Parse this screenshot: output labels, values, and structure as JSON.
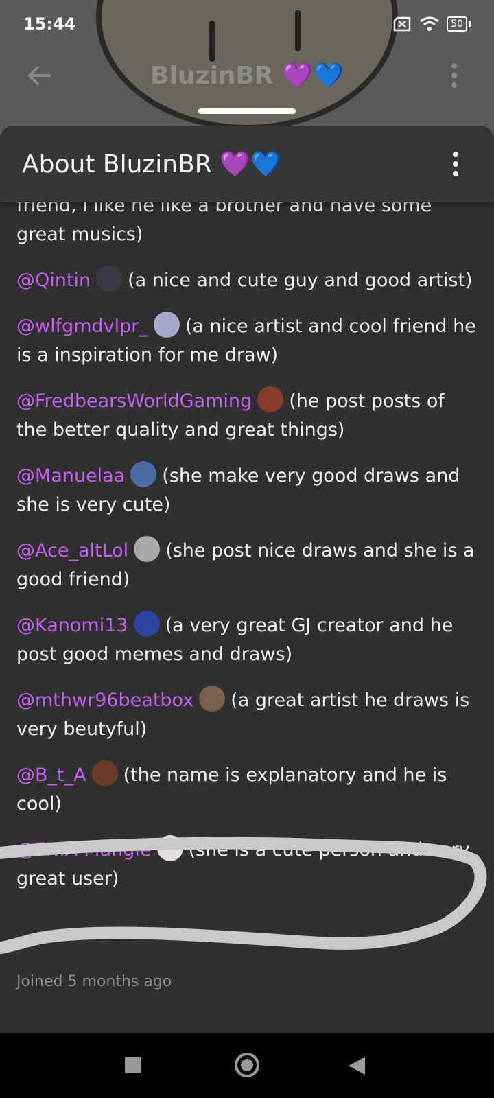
{
  "status_bar": {
    "time": "15:44",
    "battery": "50",
    "icons": [
      "no-sim-icon",
      "wifi-icon",
      "battery-icon"
    ]
  },
  "profile_header": {
    "title": "BluzinBR 💜💙"
  },
  "sheet": {
    "title": "About BluzinBR 💜💙",
    "intro": "friend, i like he like a brother and have some great musics)",
    "entries": [
      {
        "mention": "@Qintin",
        "text": "(a nice and cute guy and good artist)",
        "avatar_color": "#3a3a45"
      },
      {
        "mention": "@wlfgmdvlpr_",
        "text": "(a nice artist and cool friend he is a inspiration for me draw)",
        "avatar_color": "#a9a7c9"
      },
      {
        "mention": "@FredbearsWorldGaming",
        "text": "(he post posts of the better quality and great things)",
        "avatar_color": "#8a3b2e"
      },
      {
        "mention": "@Manuelaa",
        "text": "(she make very good draws and she is very cute)",
        "avatar_color": "#4a6da8"
      },
      {
        "mention": "@Ace_altLol",
        "text": "(she post nice draws and she is a good friend)",
        "avatar_color": "#a9a9a9"
      },
      {
        "mention": "@Kanomi13",
        "text": "(a very great GJ creator and he post good memes and draws)",
        "avatar_color": "#2b44a0"
      },
      {
        "mention": "@mthwr96beatbox",
        "text": "(a great artist he draws is very beutyful)",
        "avatar_color": "#7a6050"
      },
      {
        "mention": "@B_t_A",
        "text": "(the name is explanatory and he is cool)",
        "avatar_color": "#6b3a2a"
      },
      {
        "mention": "@FNIA-Mangle",
        "text": "(she is a cute person and very great user)",
        "avatar_color": "#e9dde0"
      }
    ],
    "joined": "Joined 5 months ago"
  },
  "colors": {
    "mention": "#c35ff0",
    "sheet_bg": "#2f302f",
    "highlight_stroke": "#c9c9c9"
  }
}
